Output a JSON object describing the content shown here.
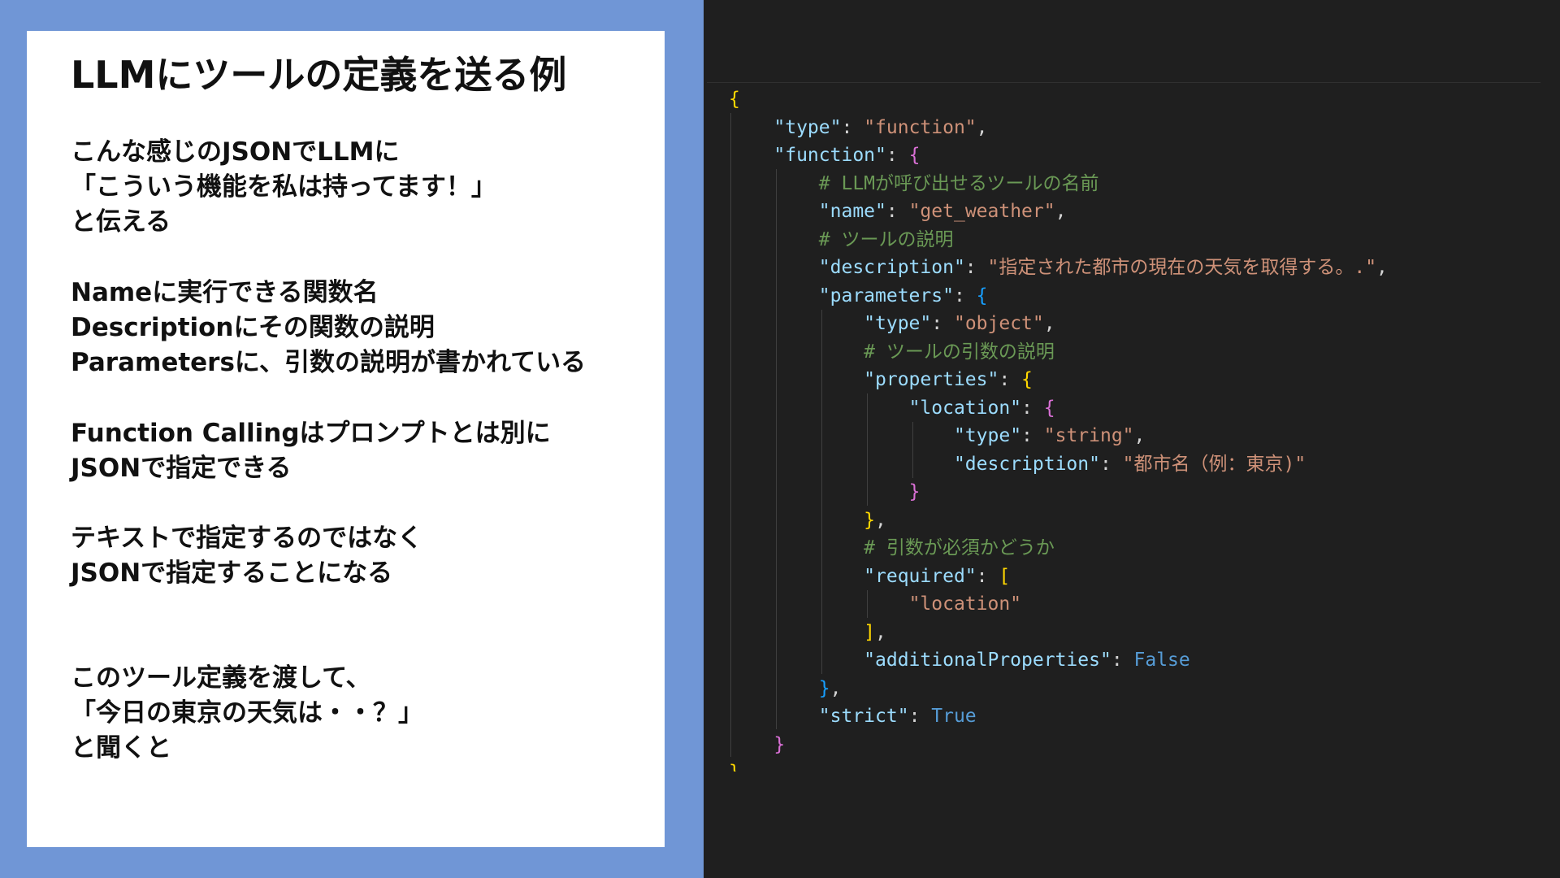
{
  "slide": {
    "title": "LLMにツールの定義を送る例",
    "paragraphs": [
      [
        "こんな感じのJSONでLLMに",
        "「こういう機能を私は持ってます！」",
        "と伝える"
      ],
      [
        "Nameに実行できる関数名",
        "Descriptionにその関数の説明",
        "Parametersに、引数の説明が書かれている"
      ],
      [
        "Function Callingはプロンプトとは別に",
        "JSONで指定できる"
      ],
      [
        "テキストで指定するのではなく",
        "JSONで指定することになる"
      ],
      [
        "このツール定義を渡して、",
        "「今日の東京の天気は・・？」",
        "と聞くと"
      ]
    ]
  },
  "code": {
    "l0": [
      "{"
    ],
    "l1": [
      "\"type\"",
      ": ",
      "\"function\"",
      ","
    ],
    "l2": [
      "\"function\"",
      ": ",
      "{"
    ],
    "l3": [
      "# LLMが呼び出せるツールの名前"
    ],
    "l4": [
      "\"name\"",
      ": ",
      "\"get_weather\"",
      ","
    ],
    "l5": [
      "# ツールの説明"
    ],
    "l6": [
      "\"description\"",
      ": ",
      "\"指定された都市の現在の天気を取得する。.\"",
      ","
    ],
    "l7": [
      "\"parameters\"",
      ": ",
      "{"
    ],
    "l8": [
      "\"type\"",
      ": ",
      "\"object\"",
      ","
    ],
    "l9": [
      "# ツールの引数の説明"
    ],
    "l10": [
      "\"properties\"",
      ": ",
      "{"
    ],
    "l11": [
      "\"location\"",
      ": ",
      "{"
    ],
    "l12": [
      "\"type\"",
      ": ",
      "\"string\"",
      ","
    ],
    "l13": [
      "\"description\"",
      ": ",
      "\"都市名（例：東京)\""
    ],
    "l14": [
      "}"
    ],
    "l15": [
      "}",
      ","
    ],
    "l16": [
      "# 引数が必須かどうか"
    ],
    "l17": [
      "\"required\"",
      ": ",
      "["
    ],
    "l18": [
      "\"location\""
    ],
    "l19": [
      "]",
      ","
    ],
    "l20": [
      "\"additionalProperties\"",
      ": ",
      "False"
    ],
    "l21": [
      "}",
      ","
    ],
    "l22": [
      "\"strict\"",
      ": ",
      "True"
    ],
    "l23": [
      "}"
    ],
    "l24": [
      "}"
    ]
  },
  "colors": {
    "panel_blue": "#7096d6",
    "editor_bg": "#1f1f1f",
    "key": "#9cdcfe",
    "string": "#ce9178",
    "comment": "#6a9955",
    "boolean": "#569cd6",
    "bracket_gold": "#ffd700",
    "bracket_magenta": "#da70d6",
    "bracket_blue": "#179fff"
  }
}
